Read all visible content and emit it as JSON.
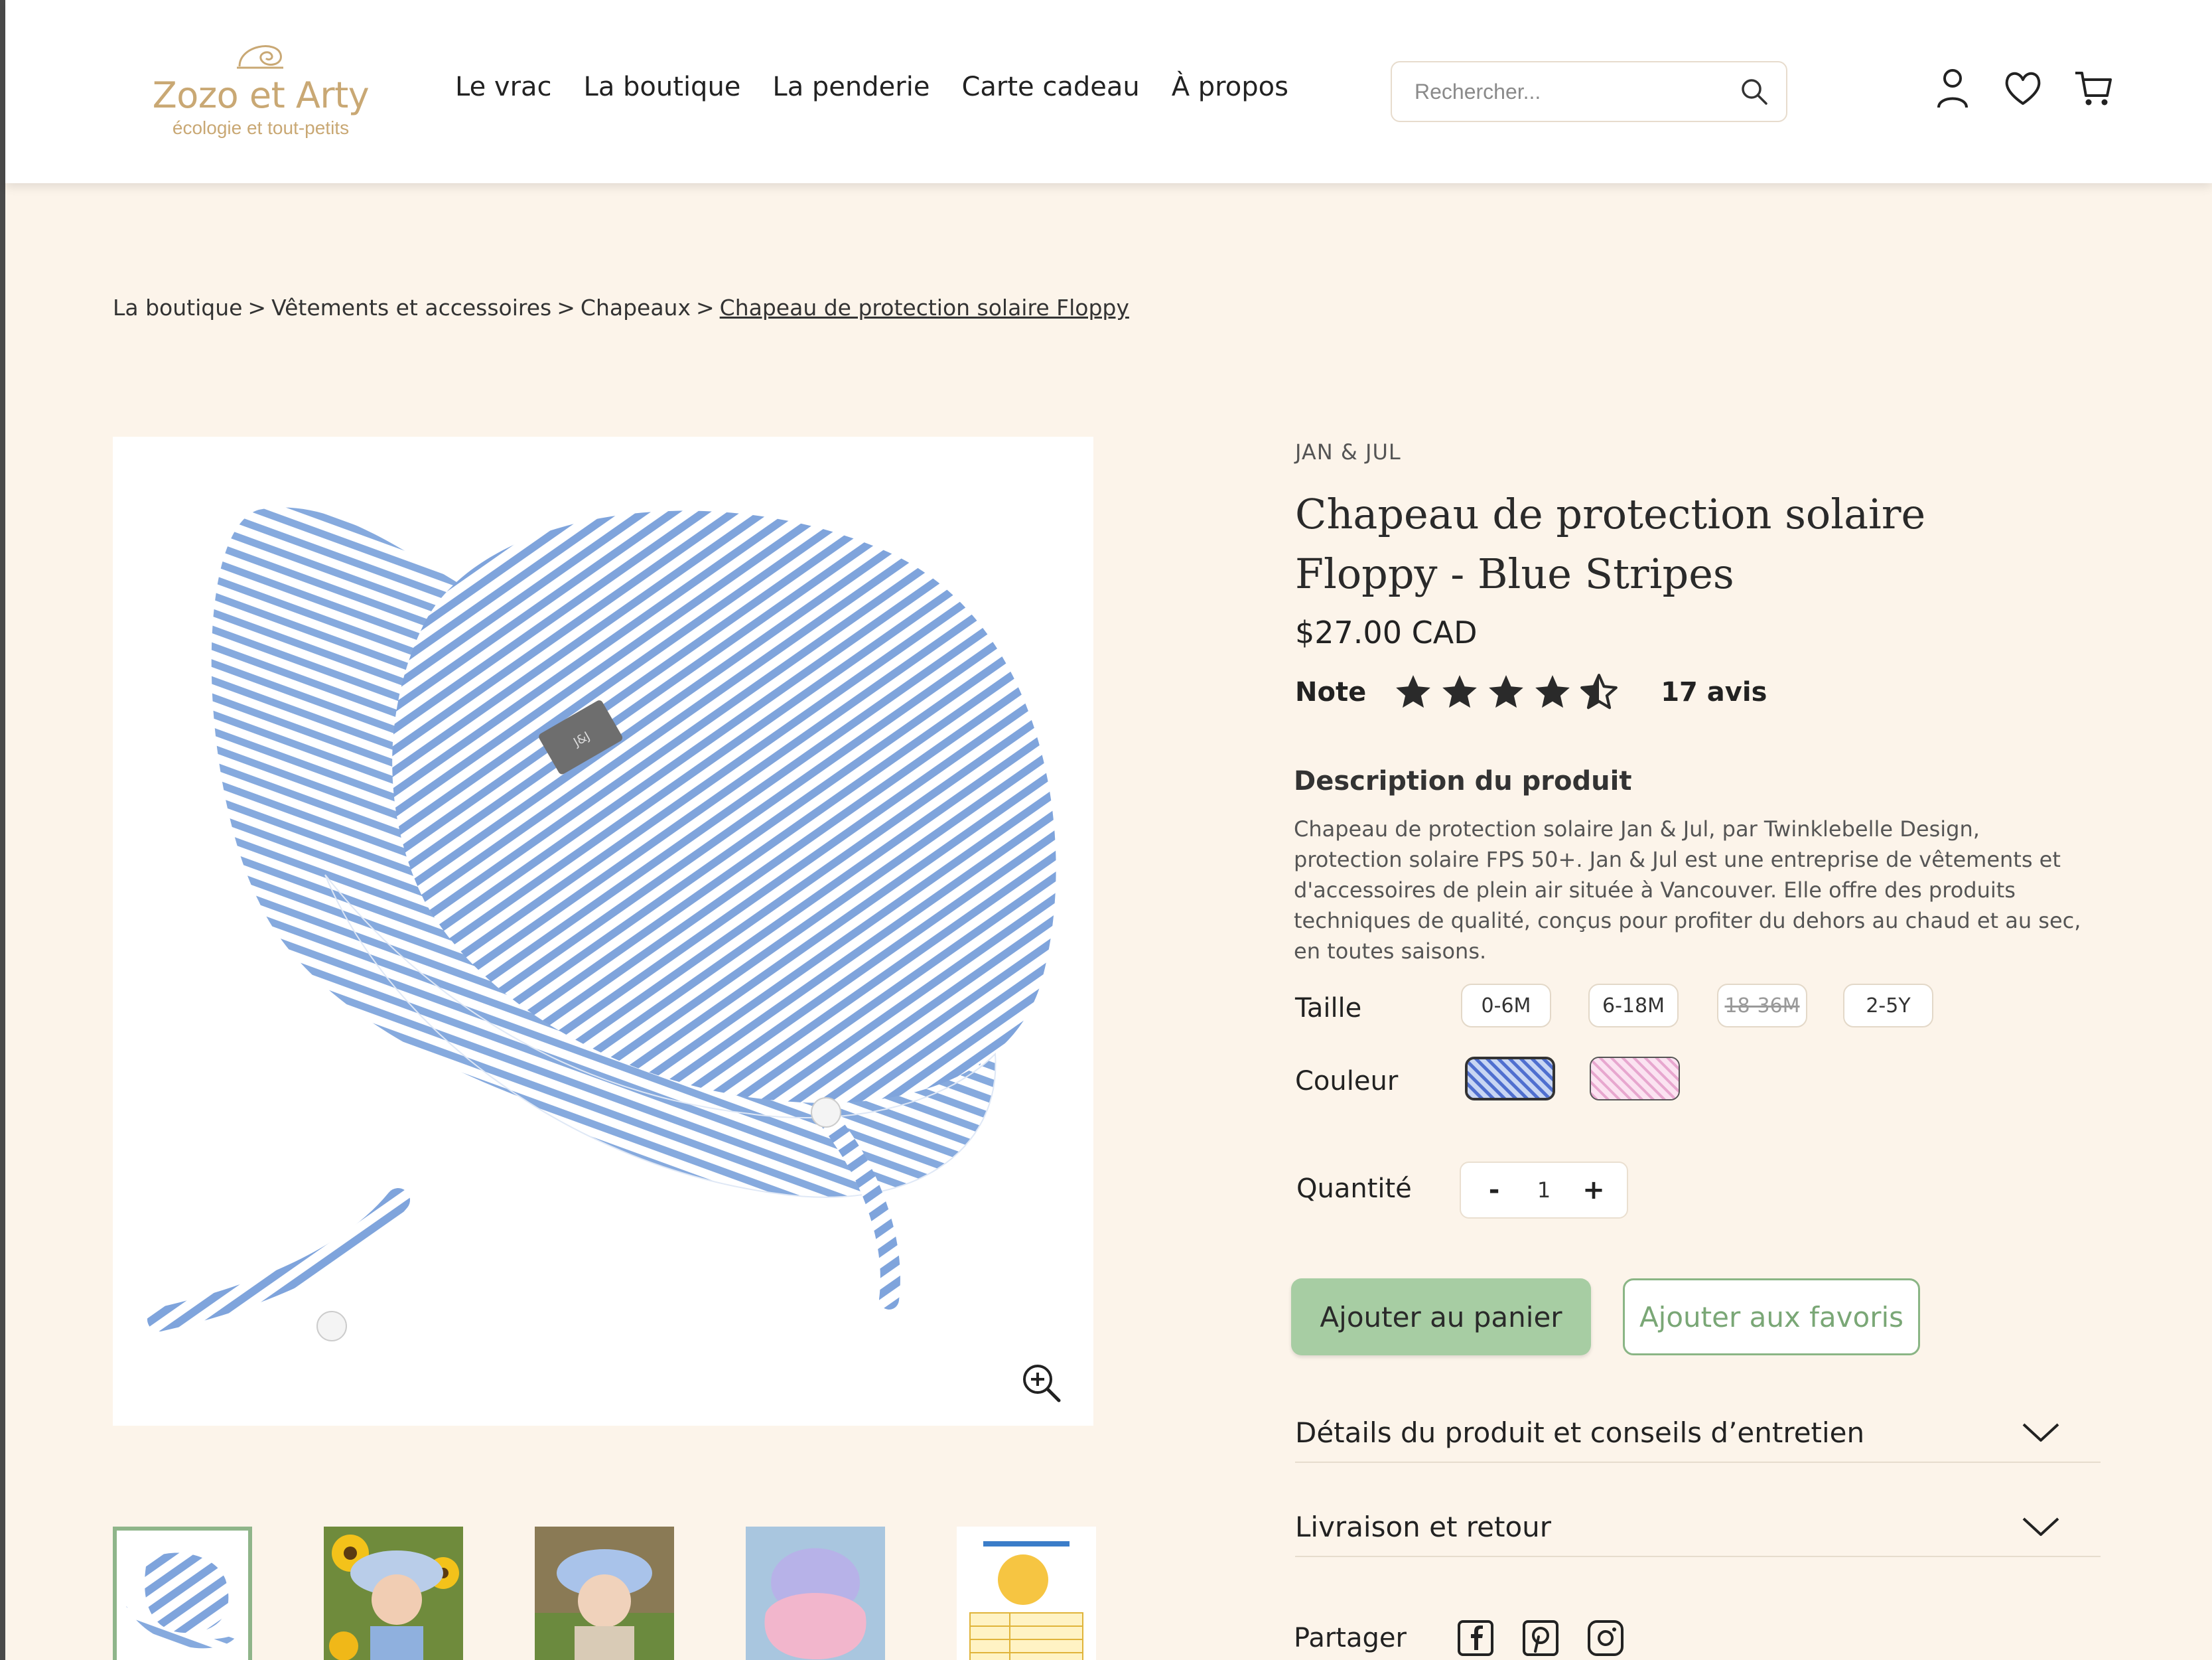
{
  "header": {
    "logo": {
      "name": "Zozo et Arty",
      "tagline": "écologie et tout-petits"
    },
    "nav": [
      "Le vrac",
      "La boutique",
      "La penderie",
      "Carte cadeau",
      "À propos"
    ],
    "search_placeholder": "Rechercher..."
  },
  "breadcrumb": {
    "items": [
      "La boutique",
      "Vêtements et accessoires",
      "Chapeaux"
    ],
    "current": "Chapeau de protection solaire Floppy",
    "separator": ">"
  },
  "product": {
    "brand": "JAN & JUL",
    "title_line1": "Chapeau de protection solaire",
    "title_line2": "Floppy - Blue Stripes",
    "price": "$27.00 CAD",
    "rating_label": "Note",
    "rating_value": 4.5,
    "rating_max": 5,
    "review_count": "17 avis",
    "description_title": "Description du produit",
    "description": "Chapeau de protection solaire Jan & Jul, par Twinklebelle Design, protection solaire FPS 50+. Jan & Jul est une entreprise de vêtements et d'accessoires de plein air située à Vancouver. Elle offre des produits techniques de qualité, conçus pour profiter du dehors au chaud et au sec, en toutes saisons.",
    "size_label": "Taille",
    "sizes": [
      "0-6M",
      "6-18M",
      "18-36M",
      "2-5Y"
    ],
    "size_unavailable": "18-36M",
    "color_label": "Couleur",
    "colors": [
      "blue-stripes",
      "pink-stripes"
    ],
    "selected_color": "blue-stripes",
    "quantity_label": "Quantité",
    "quantity": "1",
    "qty_minus": "-",
    "qty_plus": "+",
    "add_to_cart": "Ajouter au panier",
    "add_to_favorites": "Ajouter aux favoris",
    "accordions": [
      "Détails du produit et conseils d’entretien",
      "Livraison et retour"
    ],
    "share_label": "Partager"
  },
  "colors": {
    "background": "#fcf4ea",
    "accent_green": "#a7cda3",
    "logo_gold": "#c9a874",
    "stripe_blue": "#7fa4dc"
  },
  "icons": [
    "search-icon",
    "user-icon",
    "heart-icon",
    "cart-icon",
    "star-icon",
    "zoom-in-icon",
    "chevron-down-icon",
    "facebook-icon",
    "pinterest-icon",
    "instagram-icon"
  ]
}
